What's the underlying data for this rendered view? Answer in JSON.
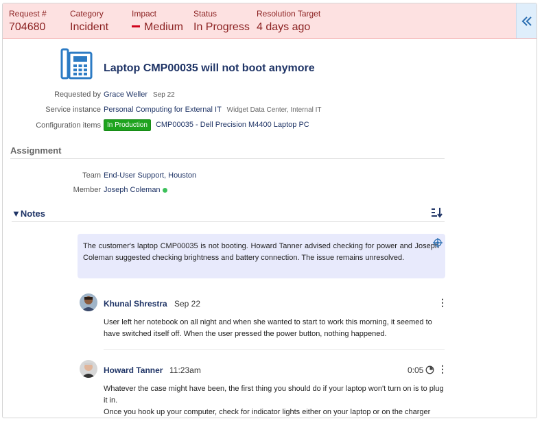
{
  "header": {
    "request_label": "Request #",
    "request_value": "704680",
    "category_label": "Category",
    "category_value": "Incident",
    "impact_label": "Impact",
    "impact_value": "Medium",
    "status_label": "Status",
    "status_value": "In Progress",
    "target_label": "Resolution Target",
    "target_value": "4 days ago",
    "collapse_icon": "double-chevron-left-icon"
  },
  "request": {
    "icon": "phone-icon",
    "title": "Laptop CMP00035 will not boot anymore",
    "requested_by_label": "Requested by",
    "requested_by": "Grace Weller",
    "requested_date": "Sep 22",
    "service_label": "Service instance",
    "service": "Personal Computing for External IT",
    "service_sub": "Widget Data Center, Internal IT",
    "ci_label": "Configuration items",
    "ci_badge": "In Production",
    "ci_value": "CMP00035 - Dell Precision M4400 Laptop PC"
  },
  "assignment": {
    "heading": "Assignment",
    "team_label": "Team",
    "team": "End-User Support, Houston",
    "member_label": "Member",
    "member": "Joseph Coleman"
  },
  "notes": {
    "heading": "▼Notes",
    "summary": "The customer's laptop CMP00035 is not booting. Howard Tanner advised checking for power and Joseph Coleman suggested checking brightness and battery connection. The issue remains unresolved.",
    "items": [
      {
        "author": "Khunal Shrestra",
        "time": "Sep 22",
        "text": "User left her notebook on all night and when she wanted to start to work this morning, it seemed to have switched itself off. When the user pressed the power button, nothing happened."
      },
      {
        "author": "Howard Tanner",
        "time": "11:23am",
        "duration": "0:05",
        "text1": "Whatever the case might have been, the first thing you should do if your laptop won't turn on is to plug it in.",
        "text2": "Once you hook up your computer, check for indicator lights either on your laptop or on the charger"
      }
    ]
  },
  "colors": {
    "header_bg": "#fde1e1",
    "header_text": "#8a1f1f",
    "link": "#1f3466",
    "badge_green": "#1ea31e",
    "summary_bg": "#e8eafc"
  }
}
